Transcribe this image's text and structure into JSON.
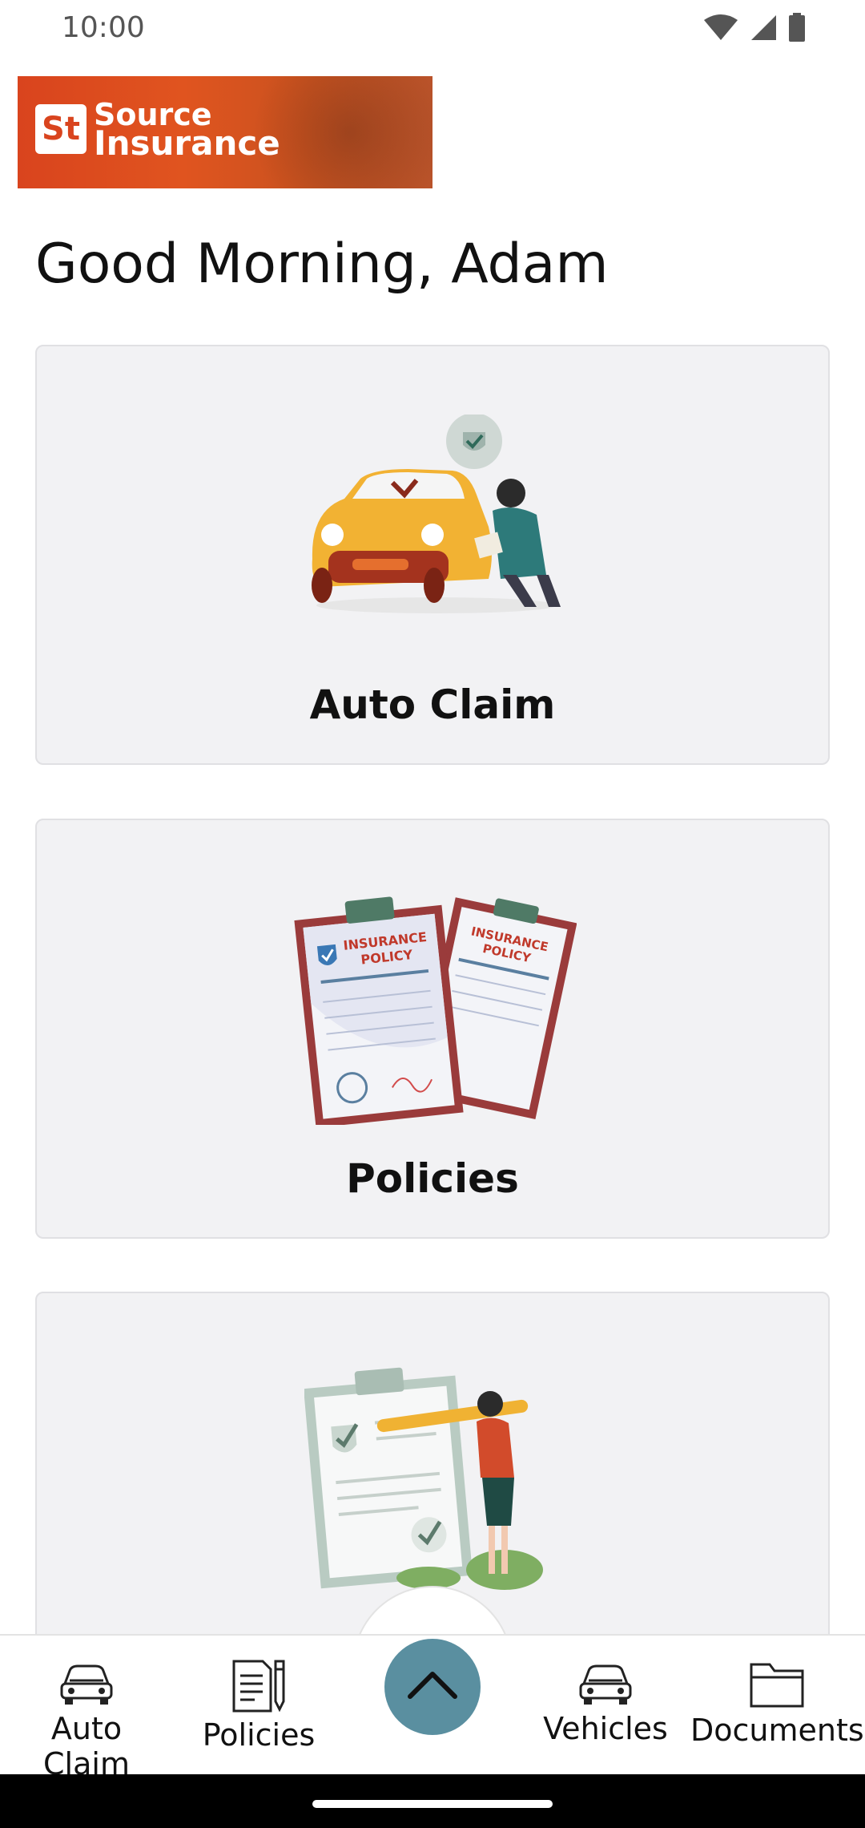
{
  "status_bar": {
    "time": "10:00"
  },
  "brand": {
    "logo_mark": "St",
    "name_line1": "Source",
    "name_line2": "Insurance",
    "accent": "#d9441e"
  },
  "greeting": "Good Morning, Adam",
  "cards": [
    {
      "label": "Auto Claim",
      "icon": "car-inspection-illustration"
    },
    {
      "label": "Policies",
      "icon": "insurance-policy-documents-illustration"
    },
    {
      "label": "",
      "icon": "checklist-illustration"
    }
  ],
  "bottom_nav": {
    "items": [
      {
        "label": "Auto Claim",
        "icon": "car-icon"
      },
      {
        "label": "Policies",
        "icon": "document-pen-icon"
      },
      {
        "label": "Vehicles",
        "icon": "car-icon"
      },
      {
        "label": "Documents",
        "icon": "folder-icon"
      }
    ],
    "fab_icon": "chevron-up-icon",
    "fab_color": "#5a8fa0"
  }
}
